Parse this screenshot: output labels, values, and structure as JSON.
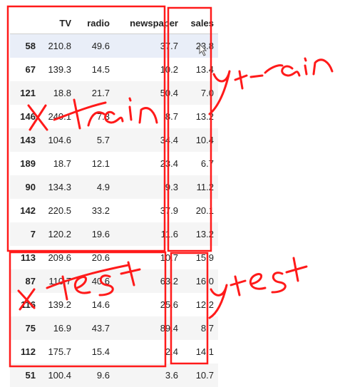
{
  "table": {
    "columns": [
      "",
      "TV",
      "radio",
      "newspaper",
      "sales"
    ],
    "rows": [
      {
        "index": "58",
        "tv": "210.8",
        "radio": "49.6",
        "newspaper": "37.7",
        "sales": "23.8"
      },
      {
        "index": "67",
        "tv": "139.3",
        "radio": "14.5",
        "newspaper": "10.2",
        "sales": "13.4"
      },
      {
        "index": "121",
        "tv": "18.8",
        "radio": "21.7",
        "newspaper": "50.4",
        "sales": "7.0"
      },
      {
        "index": "146",
        "tv": "240.1",
        "radio": "7.3",
        "newspaper": "8.7",
        "sales": "13.2"
      },
      {
        "index": "143",
        "tv": "104.6",
        "radio": "5.7",
        "newspaper": "34.4",
        "sales": "10.4"
      },
      {
        "index": "189",
        "tv": "18.7",
        "radio": "12.1",
        "newspaper": "23.4",
        "sales": "6.7"
      },
      {
        "index": "90",
        "tv": "134.3",
        "radio": "4.9",
        "newspaper": "9.3",
        "sales": "11.2"
      },
      {
        "index": "142",
        "tv": "220.5",
        "radio": "33.2",
        "newspaper": "37.9",
        "sales": "20.1"
      },
      {
        "index": "7",
        "tv": "120.2",
        "radio": "19.6",
        "newspaper": "11.6",
        "sales": "13.2"
      },
      {
        "index": "113",
        "tv": "209.6",
        "radio": "20.6",
        "newspaper": "10.7",
        "sales": "15.9"
      },
      {
        "index": "87",
        "tv": "110.7",
        "radio": "40.6",
        "newspaper": "63.2",
        "sales": "16.0"
      },
      {
        "index": "116",
        "tv": "139.2",
        "radio": "14.6",
        "newspaper": "25.6",
        "sales": "12.2"
      },
      {
        "index": "75",
        "tv": "16.9",
        "radio": "43.7",
        "newspaper": "89.4",
        "sales": "8.7"
      },
      {
        "index": "112",
        "tv": "175.7",
        "radio": "15.4",
        "newspaper": "2.4",
        "sales": "14.1"
      },
      {
        "index": "51",
        "tv": "100.4",
        "radio": "9.6",
        "newspaper": "3.6",
        "sales": "10.7"
      }
    ],
    "highlighted_row": 0
  },
  "annotations": {
    "color": "#ff1a1a",
    "x_train": "x train",
    "y_train": "y train",
    "x_test": "x test",
    "y_test": "y test"
  }
}
